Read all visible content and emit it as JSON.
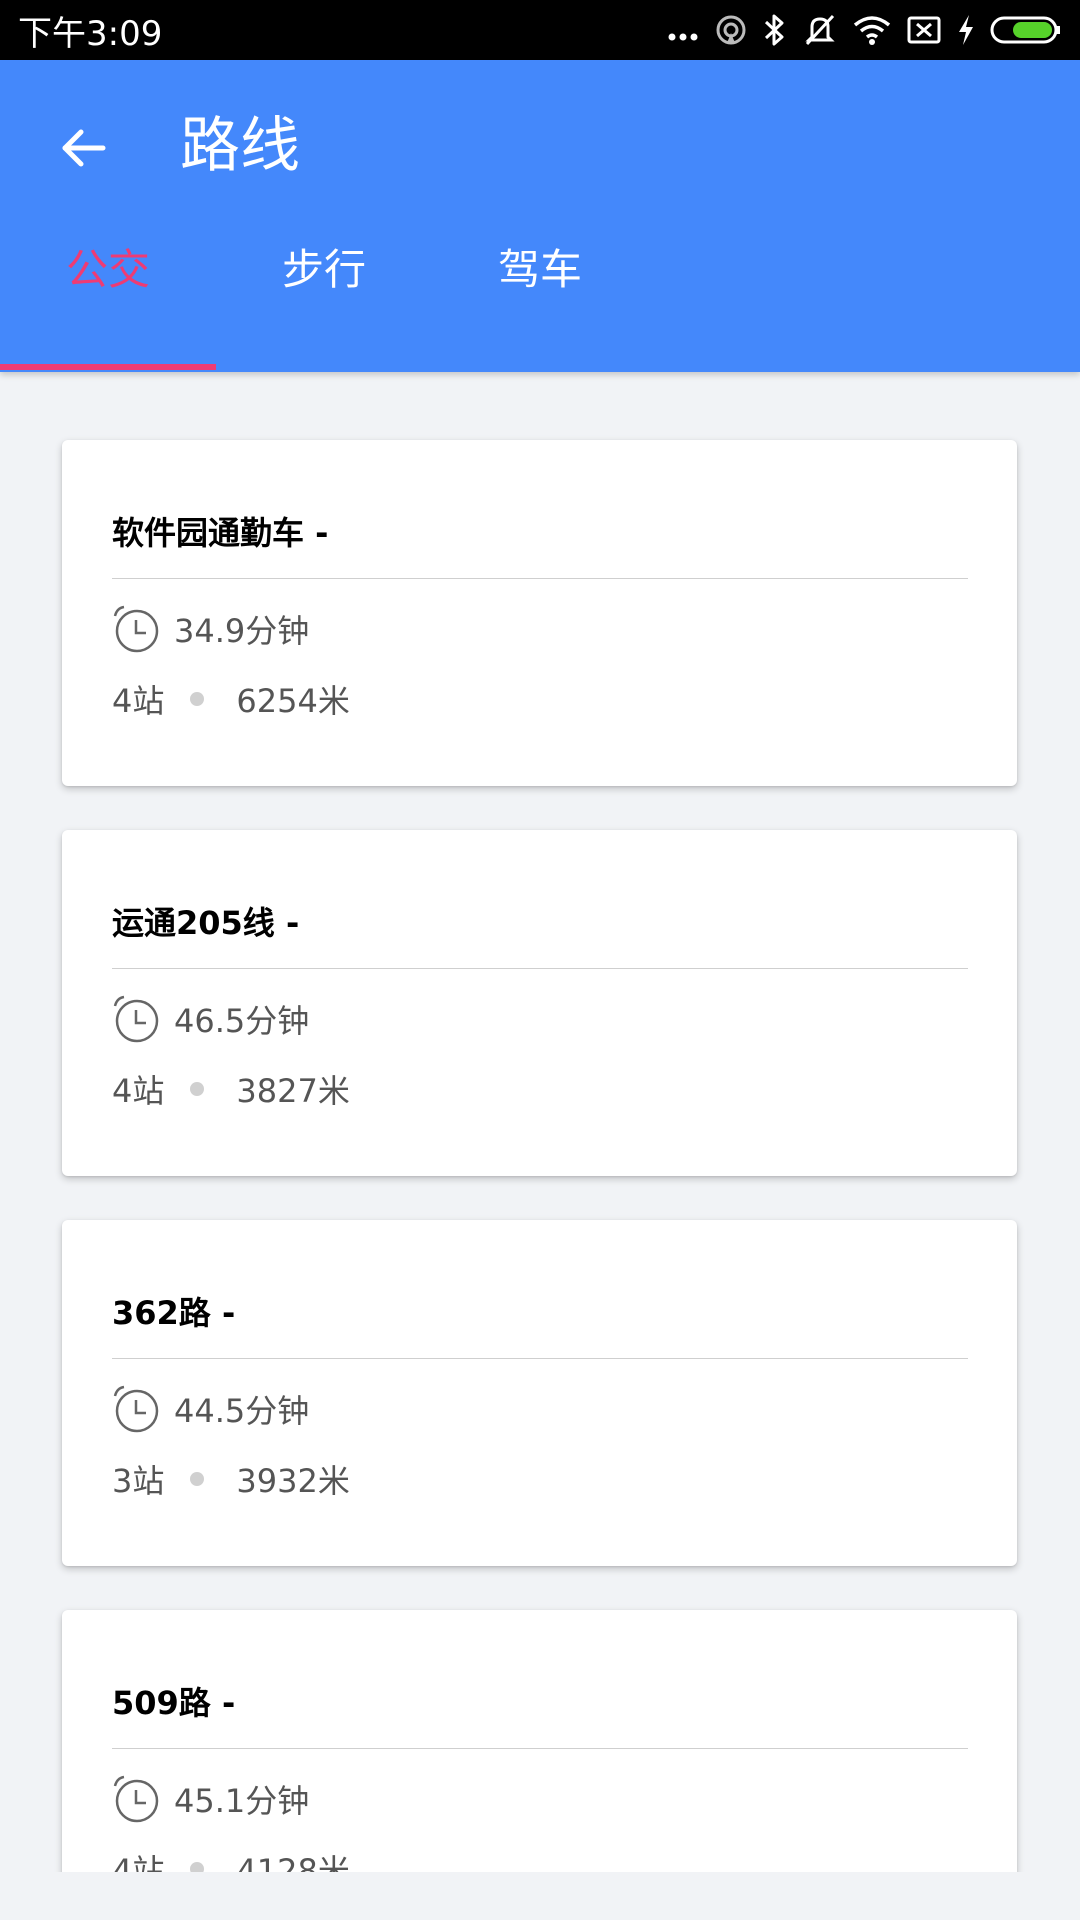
{
  "status_bar": {
    "time": "下午3:09",
    "icons": [
      "more-dots-icon",
      "hotspot-icon",
      "bluetooth-icon",
      "vibrate-off-icon",
      "wifi-icon",
      "no-sim-icon",
      "charging-icon",
      "battery-icon"
    ]
  },
  "app_bar": {
    "title": "路线",
    "back_icon": "arrow-left-icon",
    "color": "#4488fb"
  },
  "tabs": [
    {
      "label": "公交",
      "active": true
    },
    {
      "label": "步行",
      "active": false
    },
    {
      "label": "驾车",
      "active": false
    }
  ],
  "accent_color": "#ee3b74",
  "routes": [
    {
      "name": "软件园通勤车 -",
      "duration": "34.9分钟",
      "stops": "4站",
      "distance": "6254米"
    },
    {
      "name": "运通205线 -",
      "duration": "46.5分钟",
      "stops": "4站",
      "distance": "3827米"
    },
    {
      "name": "362路 -",
      "duration": "44.5分钟",
      "stops": "3站",
      "distance": "3932米"
    },
    {
      "name": "509路 -",
      "duration": "45.1分钟",
      "stops": "4站",
      "distance": "4128米"
    }
  ]
}
